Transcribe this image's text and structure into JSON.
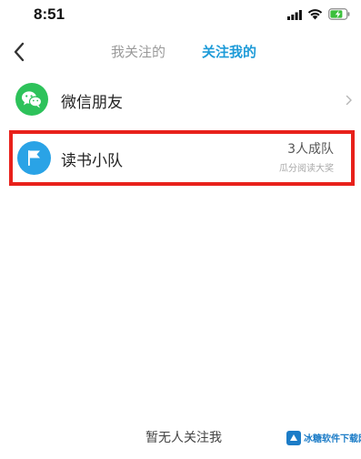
{
  "status_bar": {
    "time": "8:51",
    "signal_icon": "cellular-signal-icon",
    "wifi_icon": "wifi-icon",
    "battery_icon": "battery-charging-icon",
    "battery_color": "#3bbf3b"
  },
  "nav": {
    "back_icon": "chevron-left-icon",
    "tabs": [
      {
        "label": "我关注的",
        "active": false
      },
      {
        "label": "关注我的",
        "active": true
      }
    ],
    "active_color": "#1e9bd8",
    "inactive_color": "#9a9a9a"
  },
  "list": {
    "wechat": {
      "label": "微信朋友",
      "icon": "wechat-icon",
      "icon_color": "#2dc25a"
    },
    "book_club": {
      "label": "读书小队",
      "icon": "flag-icon",
      "icon_color": "#2aa3e6",
      "status": "3人成队",
      "subtitle": "瓜分阅读大奖"
    }
  },
  "highlight_color": "#e8211b",
  "empty_state": {
    "message": "暂无人关注我"
  },
  "watermark": {
    "text": "冰糖软件下载网"
  }
}
